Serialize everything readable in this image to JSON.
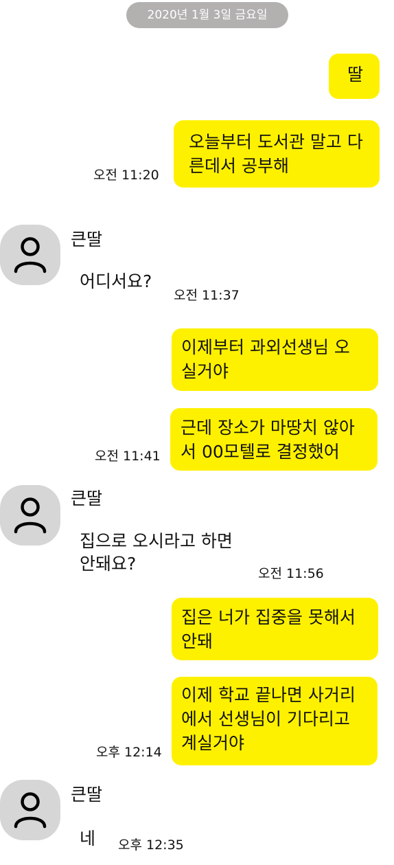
{
  "date_divider": "2020년 1월 3일 금요일",
  "sender_name": "큰딸",
  "messages": [
    {
      "text": "딸"
    },
    {
      "text": "오늘부터 도서관 말고 다\n른데서 공부해",
      "time": "오전 11:20"
    },
    {
      "text": "어디서요?",
      "time": "오전 11:37"
    },
    {
      "text": "이제부터 과외선생님 오\n실거야"
    },
    {
      "text": "근데 장소가 마땅치 않아\n서 00모텔로 결정했어",
      "time": "오전 11:41"
    },
    {
      "text": "집으로 오시라고 하면\n안돼요?",
      "time": "오전 11:56"
    },
    {
      "text": "집은 너가 집중을 못해서\n안돼"
    },
    {
      "text": "이제 학교 끝나면 사거리\n에서 선생님이 기다리고\n계실거야",
      "time": "오후 12:14"
    },
    {
      "text": "네",
      "time": "오후 12:35"
    }
  ],
  "colors": {
    "bubble": "#fef100",
    "avatar_bg": "#d6d6d6",
    "date_pill": "#b3b0b0"
  },
  "icons": {
    "avatar": "person-icon"
  }
}
